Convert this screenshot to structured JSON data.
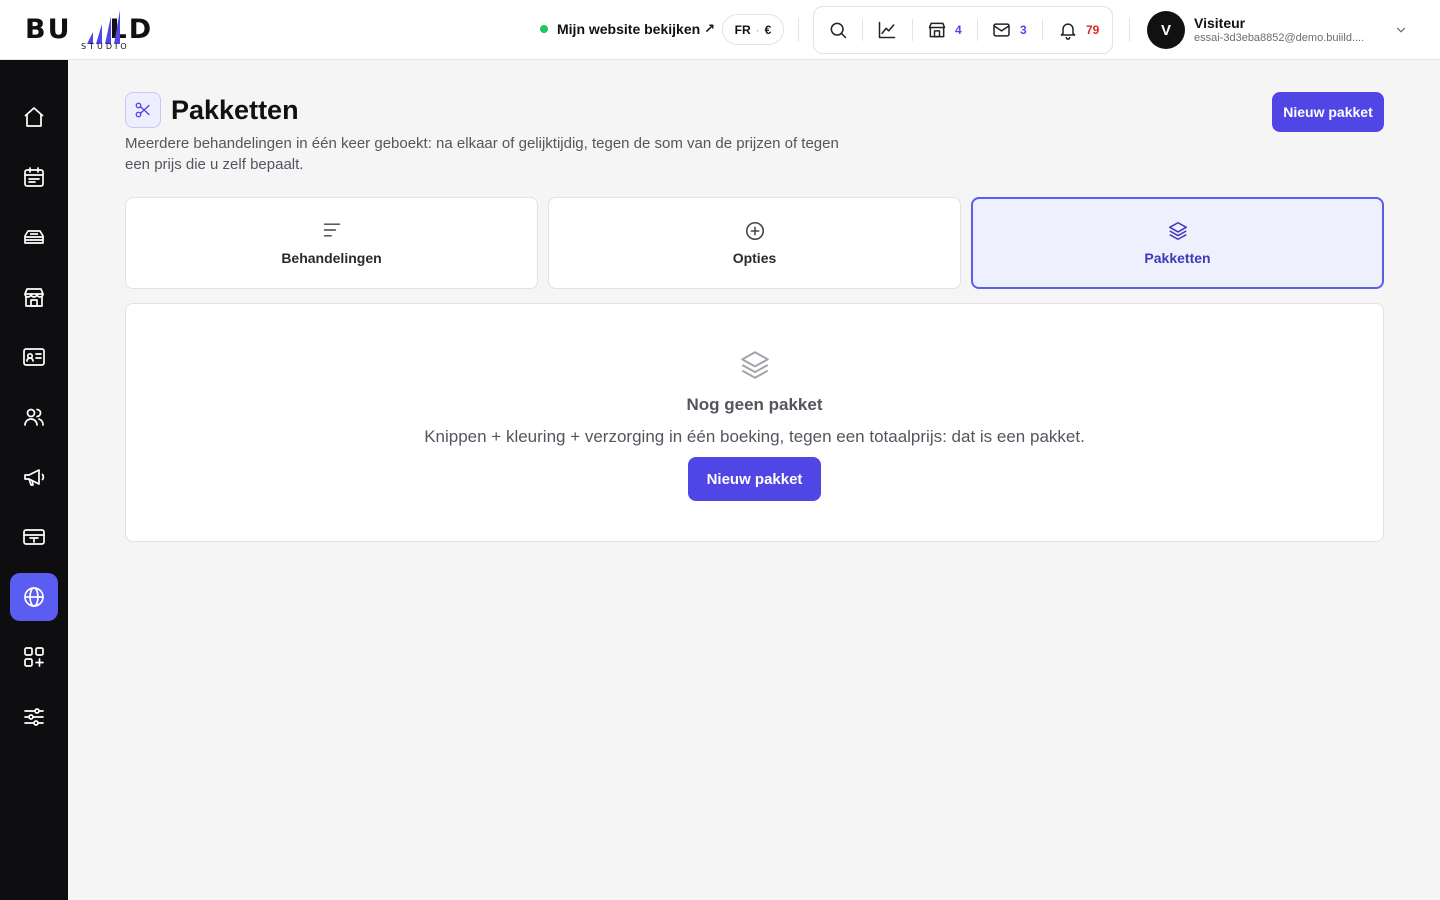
{
  "brand": {
    "logo_left": "BU",
    "logo_right": "LD",
    "logo_sub": "STUDIO",
    "accent": "#4f46e5"
  },
  "topbar": {
    "site_link": "Mijn website bekijken",
    "site_link_icon": "arrow-up-right-icon",
    "site_status_color": "#22c55e",
    "locale_lang": "FR",
    "locale_currency": "€",
    "tools": [
      {
        "icon": "search-icon"
      },
      {
        "icon": "chart-icon"
      },
      {
        "icon": "store-icon",
        "count": "4"
      },
      {
        "icon": "mail-icon",
        "count": "3"
      },
      {
        "icon": "bell-icon",
        "count": "79"
      }
    ],
    "user": {
      "initial": "V",
      "name": "Visiteur",
      "email": "essai-3d3eba8852@demo.buiild...."
    }
  },
  "sidebar": {
    "items": [
      {
        "icon": "home-icon"
      },
      {
        "icon": "calendar-icon"
      },
      {
        "icon": "treatments-icon"
      },
      {
        "icon": "shop-icon"
      },
      {
        "icon": "contact-card-icon"
      },
      {
        "icon": "users-icon"
      },
      {
        "icon": "megaphone-icon"
      },
      {
        "icon": "payment-terminal-icon"
      },
      {
        "icon": "globe-icon",
        "active": true
      },
      {
        "icon": "apps-add-icon"
      },
      {
        "icon": "sliders-icon"
      }
    ]
  },
  "page": {
    "title": "Pakketten",
    "title_icon": "scissors-icon",
    "description": "Meerdere behandelingen in één keer geboekt: na elkaar of gelijktijdig, tegen de som van de prijzen of tegen een prijs die u zelf bepaalt.",
    "new_button": "Nieuw pakket"
  },
  "tabs": [
    {
      "label": "Behandelingen",
      "icon": "list-icon",
      "active": false
    },
    {
      "label": "Opties",
      "icon": "plus-circle-icon",
      "active": false
    },
    {
      "label": "Pakketten",
      "icon": "layers-icon",
      "active": true
    }
  ],
  "empty_state": {
    "icon": "layers-icon",
    "title": "Nog geen pakket",
    "text": "Knippen + kleuring + verzorging in één boeking, tegen een totaalprijs: dat is een pakket.",
    "button": "Nieuw pakket"
  }
}
